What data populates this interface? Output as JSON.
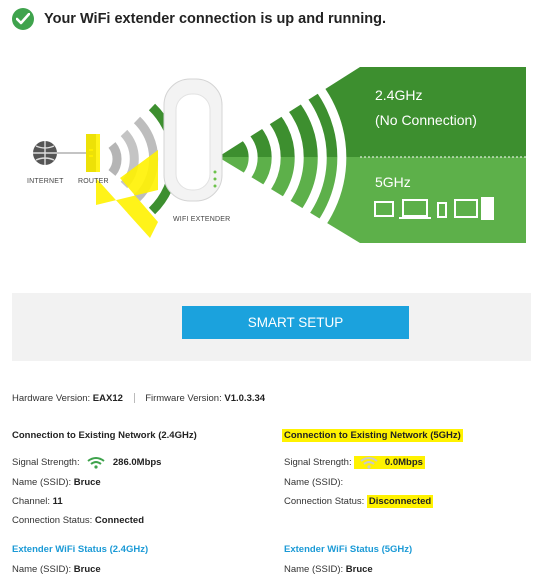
{
  "header": {
    "title": "Your WiFi extender connection is up and running."
  },
  "diagram": {
    "internet_label": "INTERNET",
    "router_label": "ROUTER",
    "extender_label": "WIFI EXTENDER",
    "band_24": {
      "label": "2.4GHz",
      "status": "(No Connection)",
      "color": "#3d8f2f"
    },
    "band_5": {
      "label": "5GHz",
      "color": "#5db04a"
    }
  },
  "setup_button": {
    "label": "SMART SETUP",
    "color": "#1ba2dd"
  },
  "versions": {
    "hardware_label": "Hardware Version:",
    "hardware_value": "EAX12",
    "firmware_label": "Firmware Version:",
    "firmware_value": "V1.0.3.34"
  },
  "existing_24": {
    "title": "Connection to Existing Network (2.4GHz)",
    "signal_label": "Signal Strength:",
    "signal_value": "286.0Mbps",
    "name_label": "Name (SSID):",
    "name_value": "Bruce",
    "channel_label": "Channel:",
    "channel_value": "11",
    "status_label": "Connection Status:",
    "status_value": "Connected"
  },
  "existing_5": {
    "title": "Connection to Existing Network (5GHz)",
    "signal_label": "Signal Strength:",
    "signal_value": "0.0Mbps",
    "name_label": "Name (SSID):",
    "name_value": "",
    "status_label": "Connection Status:",
    "status_value": "Disconnected"
  },
  "extender_24": {
    "title": "Extender WiFi Status (2.4GHz)",
    "name_label": "Name (SSID):",
    "name_value": "Bruce"
  },
  "extender_5": {
    "title": "Extender WiFi Status (5GHz)",
    "name_label": "Name (SSID):",
    "name_value": "Bruce"
  }
}
